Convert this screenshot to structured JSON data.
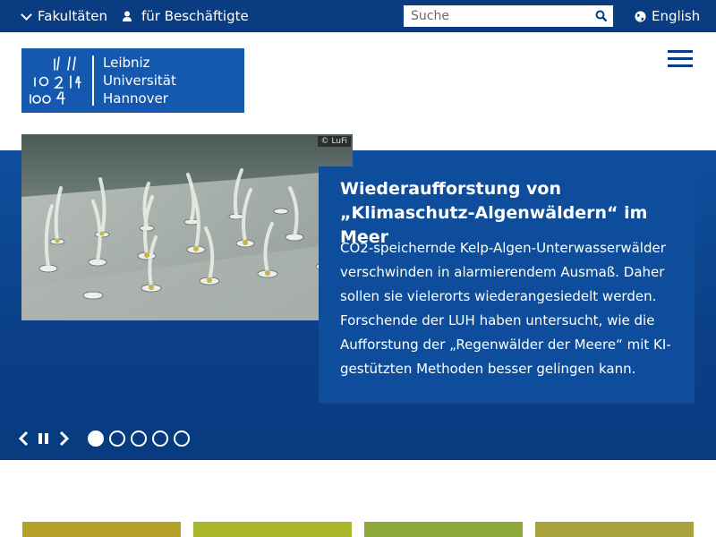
{
  "topbar": {
    "faculties_label": "Fakultäten",
    "staff_label": "für Beschäftigte",
    "search_placeholder": "Suche",
    "language_label": "English"
  },
  "logo": {
    "line1": "Leibniz",
    "line2": "Universität",
    "line3": "Hannover"
  },
  "hero": {
    "image_credit": "© LuFi",
    "title": "Wiederaufforstung von „Klimaschutz-Algenwäldern“ im Meer",
    "text": "CO2-speichernde Kelp-Algen-Unterwasserwälder verschwinden in alarmierendem Ausmaß. Daher sollen sie vielerorts wiederangesiedelt werden. Forschende der LUH haben untersucht, wie die Aufforstung der „Regenwälder der Meere“ mit KI-gestützten Methoden besser gelingen kann.",
    "slide_count": 5,
    "active_slide": 1
  },
  "colors": {
    "topbar": "#0a3c82",
    "logo": "#1558b0",
    "hero": "#0a3f86",
    "tiles": [
      "#b6a12a",
      "#a9b62b",
      "#8fa93a",
      "#a8a23b"
    ]
  },
  "icons": {
    "faculties": "chevron-down-icon",
    "staff": "person-icon",
    "search": "search-icon",
    "language": "globe-icon",
    "menu": "hamburger-icon",
    "prev": "chevron-left-icon",
    "pause": "pause-icon",
    "next": "chevron-right-icon"
  }
}
